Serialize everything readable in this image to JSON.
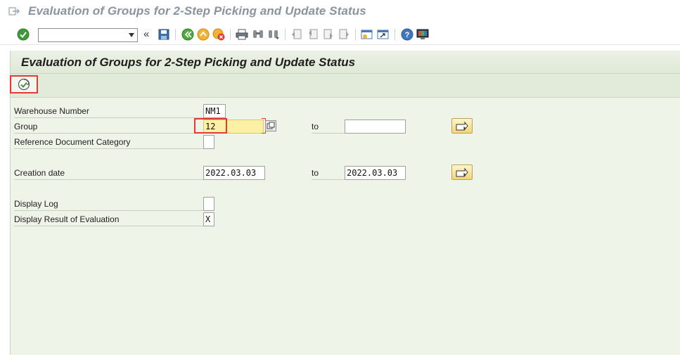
{
  "window": {
    "title": "Evaluation of Groups for 2-Step Picking and Update Status"
  },
  "toolbar": {
    "command_field_value": "",
    "back_glyph": "«"
  },
  "screen": {
    "title": "Evaluation of Groups for 2-Step Picking and Update Status",
    "execute_icon": "execute-icon"
  },
  "form": {
    "warehouse_number": {
      "label": "Warehouse Number",
      "value": "NM1"
    },
    "group": {
      "label": "Group",
      "from": "12",
      "to_label": "to",
      "to": ""
    },
    "reference_document_category": {
      "label": "Reference Document Category",
      "value": ""
    },
    "creation_date": {
      "label": "Creation date",
      "from": "2022.03.03",
      "to_label": "to",
      "to": "2022.03.03"
    },
    "display_log": {
      "label": "Display Log",
      "value": ""
    },
    "display_result": {
      "label": "Display Result of Evaluation",
      "value": "X"
    }
  },
  "colors": {
    "background": "#eff4e8",
    "focus_field": "#fcf0a5",
    "highlight": "#e53935",
    "title_grey": "#8a949e"
  }
}
